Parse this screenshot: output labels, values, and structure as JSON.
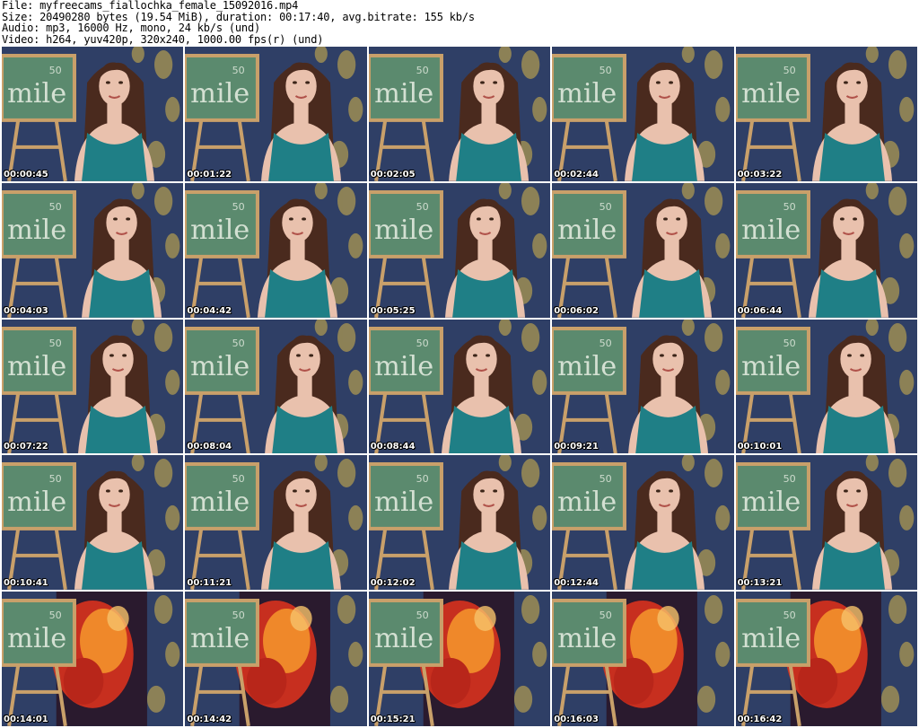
{
  "header": {
    "file": "File: myfreecams_fiallochka_female_15092016.mp4",
    "size": "Size: 20490280 bytes (19.54 MiB), duration: 00:17:40, avg.bitrate: 155 kb/s",
    "audio": "Audio: mp3, 16000 Hz, mono, 24 kb/s (und)",
    "video": "Video: h264, yuv420p, 320x240, 1000.00 fps(r) (und)"
  },
  "board_text": {
    "word": "mile",
    "number": "50"
  },
  "thumbnails": [
    {
      "timestamp": "00:00:45",
      "scene": "person"
    },
    {
      "timestamp": "00:01:22",
      "scene": "person"
    },
    {
      "timestamp": "00:02:05",
      "scene": "person"
    },
    {
      "timestamp": "00:02:44",
      "scene": "person"
    },
    {
      "timestamp": "00:03:22",
      "scene": "person"
    },
    {
      "timestamp": "00:04:03",
      "scene": "person"
    },
    {
      "timestamp": "00:04:42",
      "scene": "person"
    },
    {
      "timestamp": "00:05:25",
      "scene": "person"
    },
    {
      "timestamp": "00:06:02",
      "scene": "person"
    },
    {
      "timestamp": "00:06:44",
      "scene": "person"
    },
    {
      "timestamp": "00:07:22",
      "scene": "person"
    },
    {
      "timestamp": "00:08:04",
      "scene": "person"
    },
    {
      "timestamp": "00:08:44",
      "scene": "person"
    },
    {
      "timestamp": "00:09:21",
      "scene": "person"
    },
    {
      "timestamp": "00:10:01",
      "scene": "person"
    },
    {
      "timestamp": "00:10:41",
      "scene": "person"
    },
    {
      "timestamp": "00:11:21",
      "scene": "person"
    },
    {
      "timestamp": "00:12:02",
      "scene": "person"
    },
    {
      "timestamp": "00:12:44",
      "scene": "person"
    },
    {
      "timestamp": "00:13:21",
      "scene": "person"
    },
    {
      "timestamp": "00:14:01",
      "scene": "empty"
    },
    {
      "timestamp": "00:14:42",
      "scene": "empty"
    },
    {
      "timestamp": "00:15:21",
      "scene": "empty"
    },
    {
      "timestamp": "00:16:03",
      "scene": "empty"
    },
    {
      "timestamp": "00:16:42",
      "scene": "empty"
    }
  ],
  "colors": {
    "wall": "#2f3f66",
    "board": "#5b8a6e",
    "easel": "#c9a06a",
    "top": "#1f7f86",
    "hair": "#4a2a1e",
    "skin": "#e9c1ad",
    "poster_red": "#d8321e",
    "poster_orange": "#f3922b",
    "poster_dark": "#2a1a2e"
  }
}
